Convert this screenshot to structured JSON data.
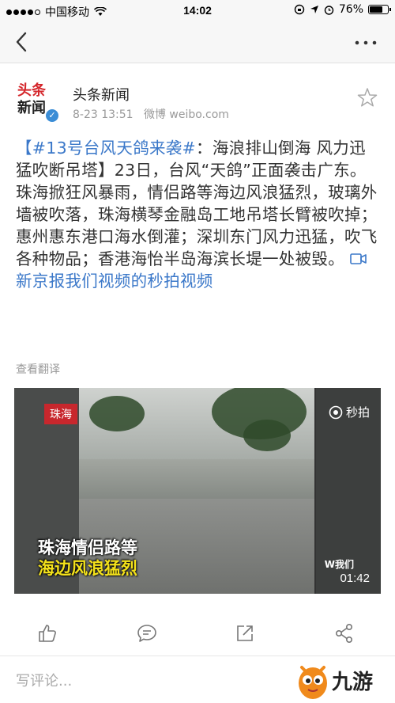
{
  "status_bar": {
    "carrier": "中国移动",
    "time": "14:02",
    "battery": "76%",
    "battery_level": 0.76
  },
  "post": {
    "author_name": "头条新闻",
    "avatar_text_line1": "头条",
    "avatar_text_line2": "新闻",
    "time": "8-23 13:51",
    "source": "微博 weibo.com",
    "hashtag": "【#13号台风天鸽来袭#",
    "text": "：海浪排山倒海 风力迅猛吹断吊塔】23日，台风“天鸽”正面袭击广东。珠海掀狂风暴雨，情侣路等海边风浪猛烈，玻璃外墙被吹落，珠海横琴金融岛工地吊塔长臂被吹掉；惠州惠东港口海水倒灌；深圳东门风力迅猛，吹飞各种物品；香港海怡半岛海滨长堤一处被毁。",
    "link_text": "新京报我们视频的秒拍视频",
    "translate": "查看翻译"
  },
  "video": {
    "city_badge": "珠海",
    "platform": "秒拍",
    "caption_line1": "珠海情侣路等",
    "caption_line2": "海边风浪猛烈",
    "watermark": "我们",
    "duration": "01:42"
  },
  "comment": {
    "placeholder": "写评论..."
  },
  "brand": {
    "name": "九游"
  },
  "colors": {
    "link": "#3b78c9",
    "badge": "#c8272d",
    "caption_yellow": "#f4e21b"
  }
}
